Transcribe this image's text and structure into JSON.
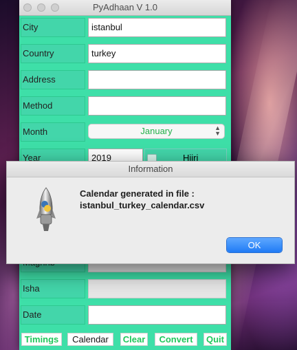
{
  "app": {
    "title": "PyAdhaan V 1.0",
    "fields": [
      {
        "label": "City",
        "value": "istanbul"
      },
      {
        "label": "Country",
        "value": "turkey"
      },
      {
        "label": "Address",
        "value": ""
      },
      {
        "label": "Method",
        "value": ""
      }
    ],
    "month": {
      "label": "Month",
      "value": "January"
    },
    "year": {
      "label": "Year",
      "value": "2019"
    },
    "hijri_label": "Hijri",
    "hidden_rows": [
      {
        "label": "Maghrib",
        "value": ""
      },
      {
        "label": "Isha",
        "value": ""
      },
      {
        "label": "Date",
        "value": ""
      }
    ],
    "buttons": {
      "timings": "Timings",
      "calendar": "Calendar",
      "clear": "Clear",
      "convert": "Convert",
      "quit": "Quit"
    },
    "colors": {
      "accent": "#3edfa8",
      "button_text": "#1fc75a",
      "month_text": "#22b04a"
    }
  },
  "dialog": {
    "title": "Information",
    "message_line1": "Calendar generated in file :",
    "message_line2": "istanbul_turkey_calendar.csv",
    "ok_label": "OK",
    "icon": "python-rocket-icon"
  }
}
